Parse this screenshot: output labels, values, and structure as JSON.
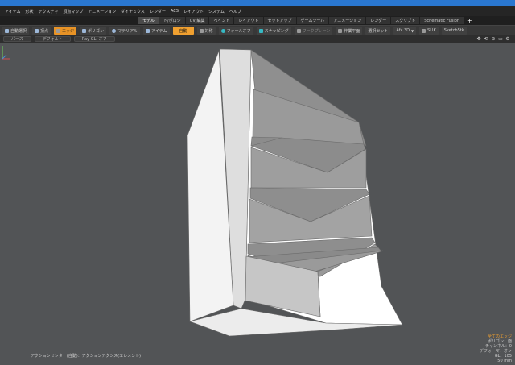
{
  "menubar": {
    "items": [
      "アイテム",
      "形状",
      "テクスチャ",
      "頂点マップ",
      "アニメーション",
      "ダイナミクス",
      "レンダー",
      "ACS",
      "レイアウト",
      "システム",
      "ヘルプ"
    ]
  },
  "tabs": {
    "items": [
      {
        "label": "モデル",
        "active": true
      },
      {
        "label": "ト/ポロジ",
        "active": false
      },
      {
        "label": "UV/編集",
        "active": false
      },
      {
        "label": "ペイント",
        "active": false
      },
      {
        "label": "レイアウト",
        "active": false
      },
      {
        "label": "セットアップ",
        "active": false
      },
      {
        "label": "ゲームツール",
        "active": false
      },
      {
        "label": "アニメーション",
        "active": false
      },
      {
        "label": "レンダー",
        "active": false
      },
      {
        "label": "スクリプト",
        "active": false
      },
      {
        "label": "Schematic Fusion",
        "active": false
      }
    ],
    "add_label": "+"
  },
  "toolbar": {
    "auto_select": "自動選択",
    "vertices": "頂点",
    "edges": "エッジ",
    "polygons": "ポリゴン",
    "materials": "マテリアル",
    "items": "アイテム",
    "action_auto": "自動",
    "symmetry": "対称",
    "falloff": "フォールオフ",
    "snapping": "スナッピング",
    "workplane_off": "ワークプレーン",
    "workplane": "作業平面",
    "select_set": "選択セット",
    "afx": "Afx 3D",
    "slik": "SLIK",
    "sketch": "SketchStk"
  },
  "viewport_header": {
    "perspective": "パース",
    "default": "デフォルト",
    "ray_gl": "Ray GL: オフ"
  },
  "viewport_controls": [
    "✥",
    "⟲",
    "⊕",
    "▭",
    "⚙"
  ],
  "status": {
    "action_center": "アクションセンター(自動)：アクションアクシス(エレメント)"
  },
  "info": {
    "all_edges": "全てのエッジ",
    "polygons": "ポリゴン：面",
    "channels": "チャンネル：0",
    "deformers": "デフォーマ：オン",
    "gl": "GL：105",
    "focal": "50 mm"
  },
  "colors": {
    "accent_blue": "#2a77d0",
    "selected_orange": "#e89326",
    "viewport_bg": "#525456",
    "info_highlight": "#f0a030"
  }
}
